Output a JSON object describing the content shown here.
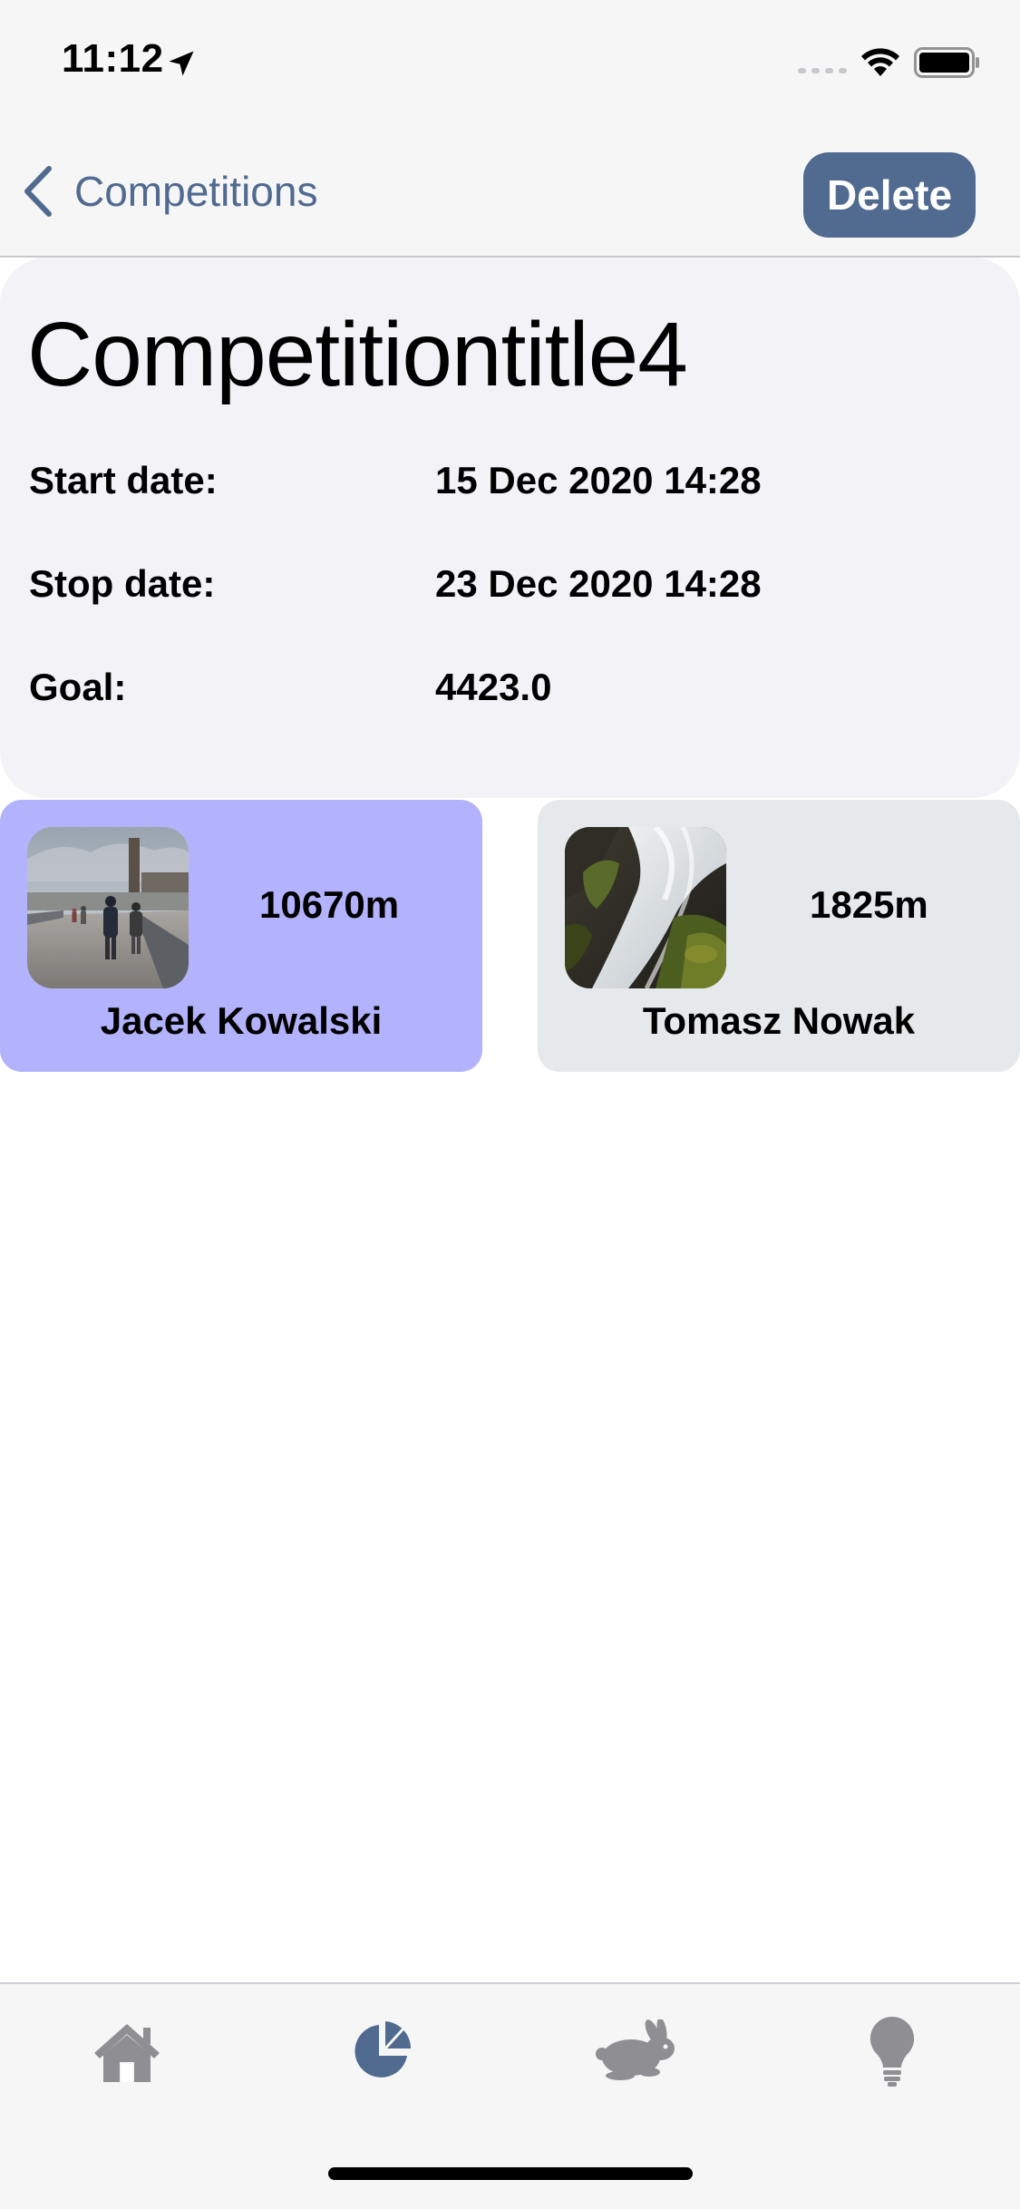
{
  "status_bar": {
    "time": "11:12"
  },
  "nav": {
    "back_label": "Competitions",
    "delete_label": "Delete"
  },
  "competition": {
    "title": "Competitiontitle4",
    "start_label": "Start date:",
    "start_value": "15 Dec 2020 14:28",
    "stop_label": "Stop date:",
    "stop_value": "23 Dec 2020 14:28",
    "goal_label": "Goal:",
    "goal_value": "4423.0"
  },
  "participants": [
    {
      "name": "Jacek Kowalski",
      "distance": "10670m",
      "card_color": "#b2b2fd"
    },
    {
      "name": "Tomasz Nowak",
      "distance": "1825m",
      "card_color": "#e6e9eb"
    }
  ],
  "tabs": [
    {
      "icon": "house-icon",
      "active": false
    },
    {
      "icon": "pie-chart-icon",
      "active": true
    },
    {
      "icon": "rabbit-icon",
      "active": false
    },
    {
      "icon": "lightbulb-icon",
      "active": false
    }
  ],
  "colors": {
    "accent": "#506a90",
    "inactive_tab": "#8e8e93",
    "details_background": "#f2f2f7"
  }
}
